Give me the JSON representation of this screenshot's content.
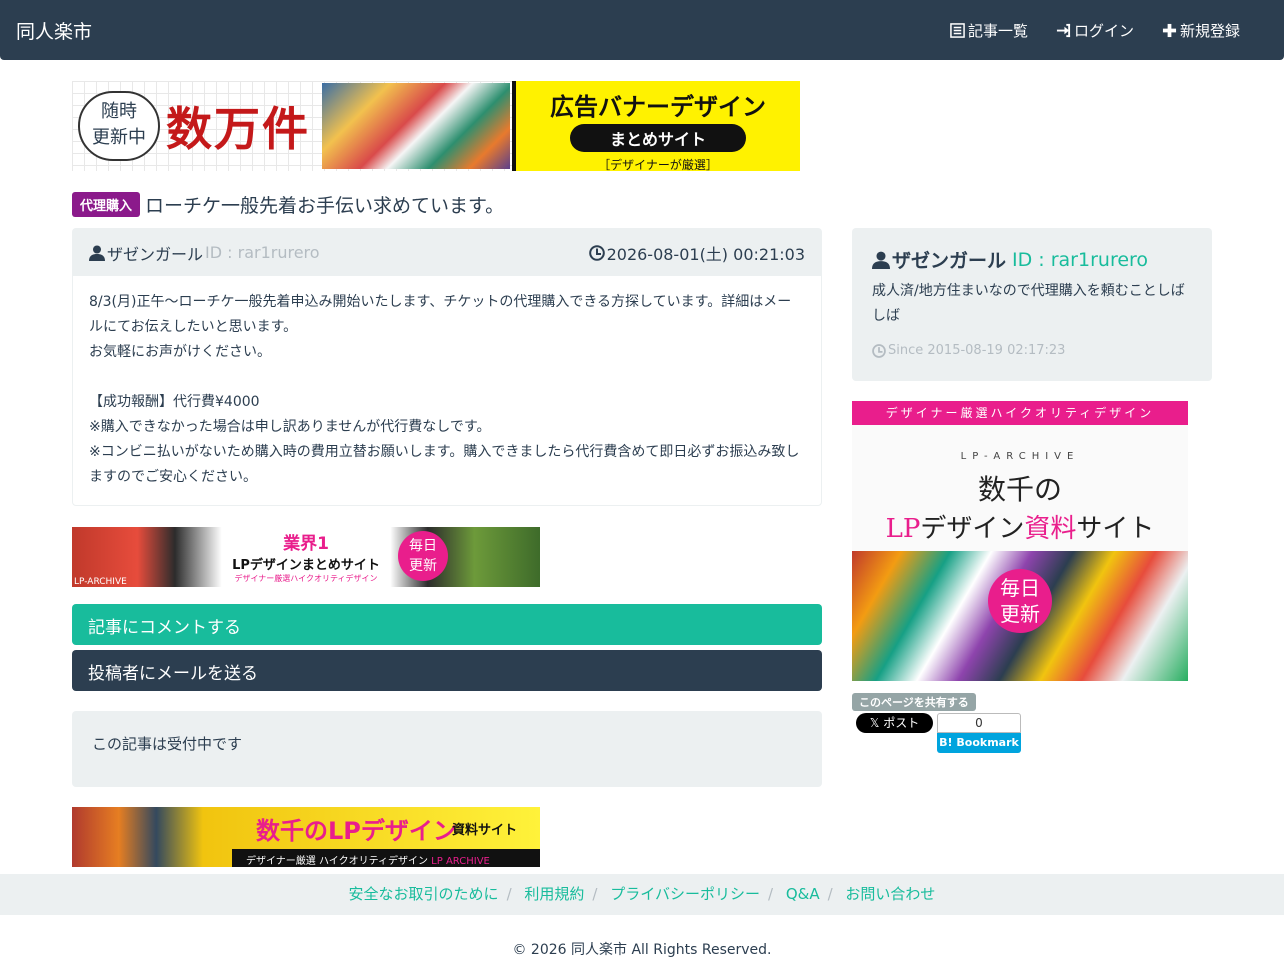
{
  "nav": {
    "brand": "同人楽市",
    "items": [
      {
        "label": "記事一覧",
        "icon": "list-icon"
      },
      {
        "label": "ログイン",
        "icon": "login-icon"
      },
      {
        "label": "新規登録",
        "icon": "plus-icon"
      }
    ]
  },
  "top_banner": {
    "stamp": "随時\n更新中",
    "big": "数万件",
    "title": "広告バナーデザイン",
    "pill": "まとめサイト",
    "sub": "［デザイナーが厳選］"
  },
  "post": {
    "category": "代理購入",
    "title": "ローチケ一般先着お手伝い求めています。",
    "author": "ザゼンガール",
    "author_id": "ID : rar1rurero",
    "datetime": "2026-08-01(土) 00:21:03",
    "body": "8/3(月)正午〜ローチケ一般先着申込み開始いたします、チケットの代理購入できる方探しています。詳細はメールにてお伝えしたいと思います。\nお気軽にお声がけください。\n\n【成功報酬】代行費¥4000\n※購入できなかった場合は申し訳ありませんが代行費なしです。\n※コンビニ払いがないため購入時の費用立替お願いします。購入できましたら代行費含めて即日必ずお振込み致しますのでご安心ください。"
  },
  "mid_banner": {
    "t1": "業界1",
    "t2": "LPデザインまとめサイト",
    "t3": "デザイナー厳選ハイクオリティデザイン",
    "badge": "毎日\n更新",
    "tag": "LP-ARCHIVE"
  },
  "buttons": {
    "comment": "記事にコメントする",
    "mail": "投稿者にメールを送る"
  },
  "status": "この記事は受付中です",
  "bottom_banner": {
    "t1": "数千のLPデザイン",
    "t2": "資料サイト",
    "strip": "デザイナー厳選 ハイクオリティデザイン",
    "strip_brand": "LP ARCHIVE"
  },
  "sidebar": {
    "name": "ザゼンガール",
    "id": "ID : rar1rurero",
    "bio": "成人済/地方住まいなので代理購入を頼むことしばしば",
    "since": "Since 2015-08-19 02:17:23",
    "ad_top": "デザイナー厳選ハイクオリティデザイン",
    "ad_arch": "LP-ARCHIVE",
    "ad_t1": "数千の",
    "ad_t2a": "LP",
    "ad_t2b": "デザイン",
    "ad_t2c": "資料",
    "ad_t2d": "サイト",
    "ad_badge": "毎日\n更新",
    "share_label": "このページを共有する",
    "x_post": "ポスト",
    "hb_count": "0",
    "hb_label": "B! Bookmark"
  },
  "footer": {
    "links": [
      "安全なお取引のために",
      "利用規約",
      "プライバシーポリシー",
      "Q&A",
      "お問い合わせ"
    ],
    "copyright": "© 2026 同人楽市 All Rights Reserved."
  },
  "colors": {
    "navbar": "#2c3e50",
    "success": "#18bc9c",
    "category": "#8b1a8b",
    "well": "#ecf0f1"
  }
}
